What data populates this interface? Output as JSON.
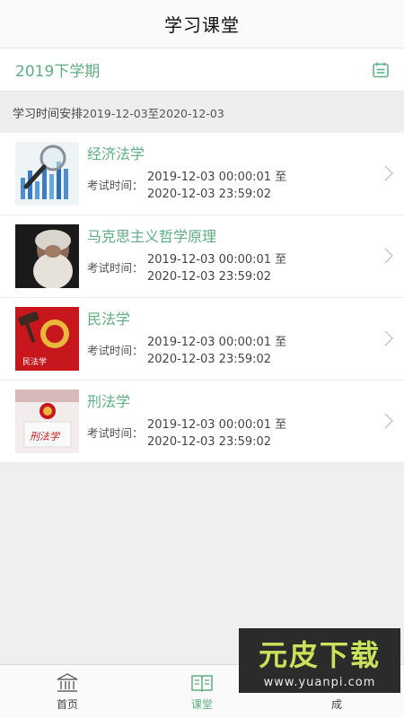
{
  "header": {
    "title": "学习课堂"
  },
  "semester": {
    "label": "2019下学期",
    "icon": "calendar-icon"
  },
  "schedule": {
    "label": "学习时间安排",
    "range": "2019-12-03至2020-12-03"
  },
  "courses": [
    {
      "name": "经济法学",
      "exam_label": "考试时间：",
      "start": "2019-12-03 00:00:01 至",
      "end": "2020-12-03 23:59:02",
      "thumb": "magnifier-chart"
    },
    {
      "name": "马克思主义哲学原理",
      "exam_label": "考试时间：",
      "start": "2019-12-03 00:00:01 至",
      "end": "2020-12-03 23:59:02",
      "thumb": "marx-portrait"
    },
    {
      "name": "民法学",
      "exam_label": "考试时间：",
      "start": "2019-12-03 00:00:01 至",
      "end": "2020-12-03 23:59:02",
      "thumb": "gavel-emblem",
      "thumb_text": "民法学"
    },
    {
      "name": "刑法学",
      "exam_label": "考试时间：",
      "start": "2019-12-03 00:00:01 至",
      "end": "2020-12-03 23:59:02",
      "thumb": "emblem-book",
      "thumb_text": "刑法学"
    }
  ],
  "tabbar": {
    "items": [
      {
        "label": "首页",
        "icon": "bank-icon",
        "active": false
      },
      {
        "label": "课堂",
        "icon": "book-icon",
        "active": true
      },
      {
        "label": "成",
        "icon": "grade-icon",
        "active": false
      }
    ]
  },
  "watermark": {
    "title": "元皮下载",
    "url": "www.yuanpi.com"
  },
  "colors": {
    "accent": "#5fae83",
    "background": "#efefef"
  }
}
